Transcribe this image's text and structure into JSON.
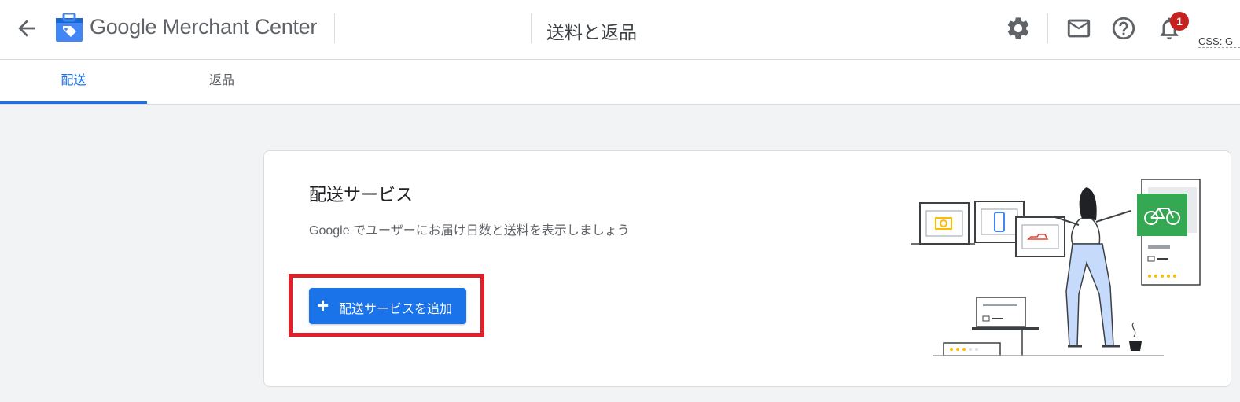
{
  "header": {
    "brand_google": "Google",
    "brand_product": "Merchant Center",
    "page_title": "送料と返品",
    "notification_count": "1",
    "css_label": "CSS: G"
  },
  "tabs": [
    {
      "label": "配送",
      "active": true
    },
    {
      "label": "返品",
      "active": false
    }
  ],
  "shipping_card": {
    "title": "配送サービス",
    "description": "Google でユーザーにお届け日数と送料を表示しましょう",
    "add_button_icon": "+",
    "add_button_label": "配送サービスを追加"
  },
  "icons": [
    "back-arrow-icon",
    "merchant-center-logo-icon",
    "gear-icon",
    "mail-icon",
    "help-icon",
    "bell-icon"
  ],
  "colors": {
    "accent": "#1a73e8",
    "highlight": "#e0212b",
    "badge": "#c5221f",
    "illustration_green": "#34a853"
  }
}
